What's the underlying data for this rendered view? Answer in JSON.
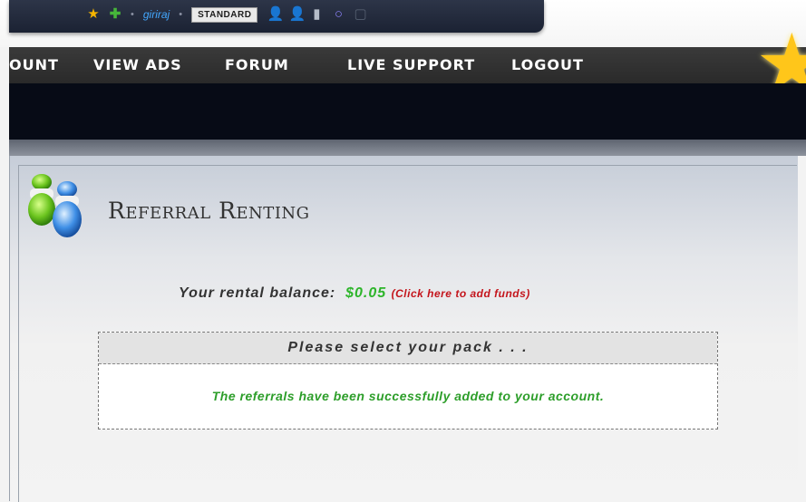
{
  "topbar": {
    "username": "giriraj",
    "member_type": "STANDARD"
  },
  "nav": {
    "items": [
      {
        "label": "OUNT"
      },
      {
        "label": "VIEW ADS"
      },
      {
        "label": "FORUM"
      },
      {
        "label": "LIVE SUPPORT"
      },
      {
        "label": "LOGOUT"
      }
    ]
  },
  "page": {
    "title": "Referral Renting",
    "balance_label": "Your rental balance:",
    "balance_value": "$0.05",
    "add_funds_link": "(Click here to add funds)",
    "pack_header": "Please select your pack . . .",
    "success_message": "The referrals have been successfully added to your account."
  },
  "colors": {
    "balance_value": "#2db52a",
    "add_funds_link": "#c4151c",
    "success_message": "#2d9e2a",
    "nav_bg": "#2f2f2f"
  },
  "icons": {
    "topbar": [
      "star-icon",
      "plus-icon",
      "user-blue-icon",
      "user-green-icon",
      "bar-icon",
      "ring-icon",
      "box-icon"
    ],
    "page": "referrals-icon",
    "corner": "star-icon"
  }
}
